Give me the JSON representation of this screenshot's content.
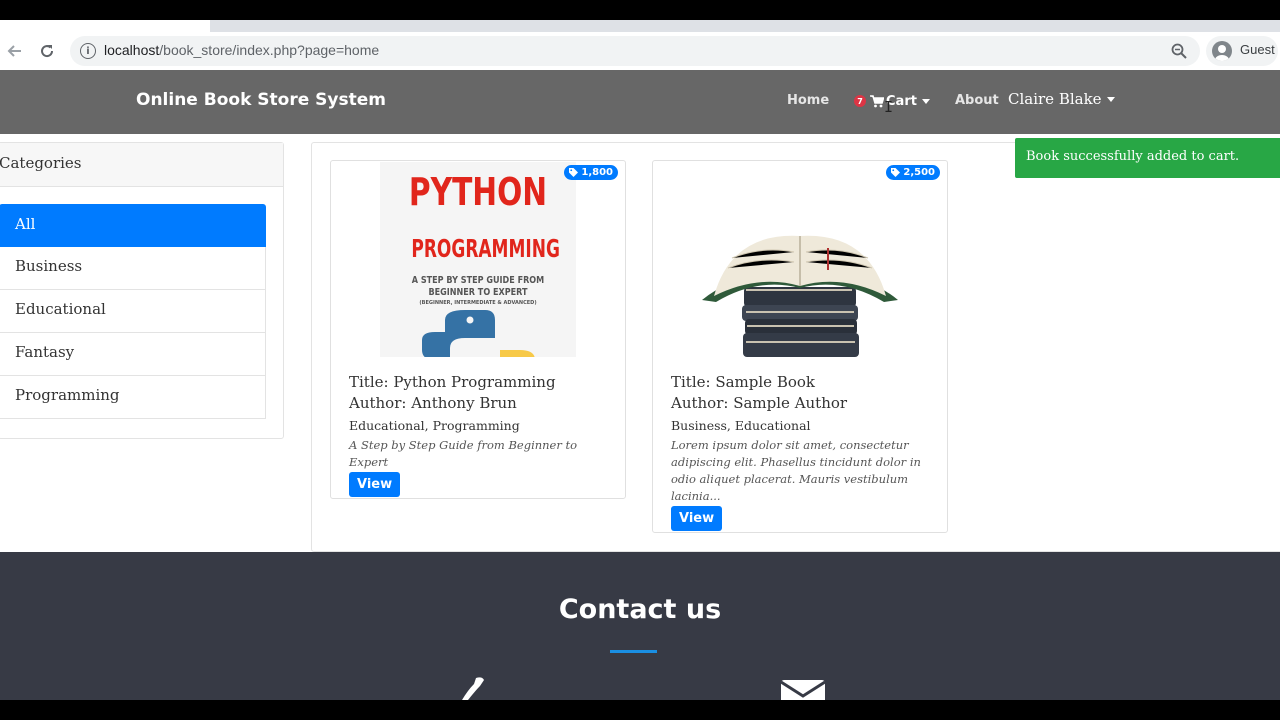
{
  "browser": {
    "url_host": "localhost",
    "url_path": "/book_store/index.php?page=home",
    "profile_label": "Guest",
    "icons": [
      "back-arrow-icon",
      "reload-icon",
      "info-icon",
      "zoom-icon",
      "account-icon"
    ]
  },
  "nav": {
    "brand": "Online Book Store System",
    "home": "Home",
    "cart_count": "7",
    "cart": "Cart",
    "about": "About",
    "user": "Claire Blake"
  },
  "categories": {
    "header": "Categories",
    "items": [
      {
        "label": "All",
        "active": true
      },
      {
        "label": "Business",
        "active": false
      },
      {
        "label": "Educational",
        "active": false
      },
      {
        "label": "Fantasy",
        "active": false
      },
      {
        "label": "Programming",
        "active": false
      }
    ]
  },
  "books": [
    {
      "price": "1,800",
      "title": "Title: Python Programming",
      "author": "Author: Anthony Brun",
      "categories": "Educational, Programming",
      "description": "A Step by Step Guide from Beginner to Expert",
      "view": "View",
      "cover": {
        "line1": "PYTHON",
        "line2": "PROGRAMMING",
        "line3": "A STEP BY STEP GUIDE FROM",
        "line4": "BEGINNER TO EXPERT",
        "line5": "(BEGINNER, INTERMEDIATE & ADVANCED)"
      }
    },
    {
      "price": "2,500",
      "title": "Title: Sample Book",
      "author": "Author: Sample Author",
      "categories": "Business, Educational",
      "description": "Lorem ipsum dolor sit amet, consectetur adipiscing elit. Phasellus tincidunt dolor in odio aliquet placerat. Mauris vestibulum lacinia...",
      "view": "View"
    }
  ],
  "toast": "Book successfully added to cart.",
  "footer": {
    "title": "Contact us",
    "accent_color": "#1a8fe3"
  },
  "colors": {
    "primary": "#007bff",
    "success": "#28a745",
    "nav_bg": "#676767",
    "footer_bg": "#373a45",
    "badge": "#dc3545"
  }
}
